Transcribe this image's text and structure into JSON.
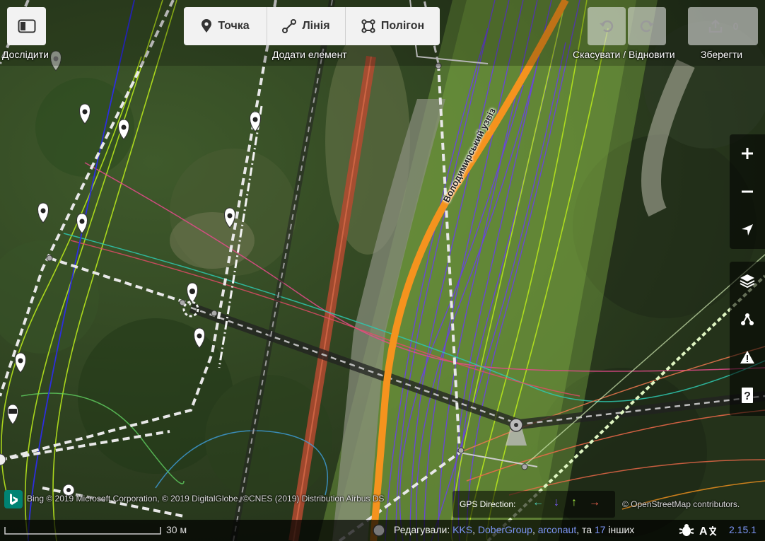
{
  "toolbar": {
    "explore_label": "Дослідити",
    "add_feature_label": "Додати елемент",
    "modes": [
      {
        "label": "Точка",
        "icon": "marker-icon"
      },
      {
        "label": "Лінія",
        "icon": "line-icon"
      },
      {
        "label": "Полігон",
        "icon": "polygon-icon"
      }
    ],
    "undo_redo_label": "Скасувати / Відновити",
    "save_label": "Зберегти",
    "save_count": "0"
  },
  "map": {
    "road_label": "Володимирський узвіз",
    "scale_label": "30 м",
    "attribution_left": "Bing © 2019 Microsoft Corporation, © 2019 DigitalGlobe, ©CNES (2019) Distribution Airbus DS",
    "attribution_right": "© OpenStreetMap contributors.",
    "gps_direction_label": "GPS Direction:",
    "gps_arrows": [
      "←",
      "↓",
      "↑",
      "→"
    ]
  },
  "footer": {
    "edited_by_label": "Редагували:",
    "editors": [
      "KKS",
      "DoberGroup",
      "arconaut"
    ],
    "and_label": "та",
    "others_count": "17",
    "others_label": "інших",
    "version": "2.15.1"
  },
  "colors": {
    "accent_orange": "#f5931e",
    "gps_purple": "#6a3df2",
    "gps_green": "#b7e61c",
    "link": "#7c95f5"
  }
}
